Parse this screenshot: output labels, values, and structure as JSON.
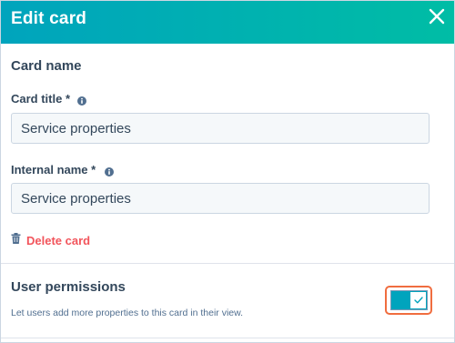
{
  "header": {
    "title": "Edit card"
  },
  "card_name_section": {
    "title": "Card name",
    "card_title_label": "Card title *",
    "card_title_value": "Service properties",
    "internal_name_label": "Internal name *",
    "internal_name_value": "Service properties",
    "delete_label": "Delete card"
  },
  "permissions_section": {
    "title": "User permissions",
    "description": "Let users add more properties to this card in their view.",
    "toggle_on": true
  },
  "colors": {
    "header_gradient_start": "#00a4bd",
    "header_gradient_end": "#00bda5",
    "delete": "#f2545b",
    "toggle_on": "#00a4bd",
    "highlight": "#f06d3f"
  }
}
